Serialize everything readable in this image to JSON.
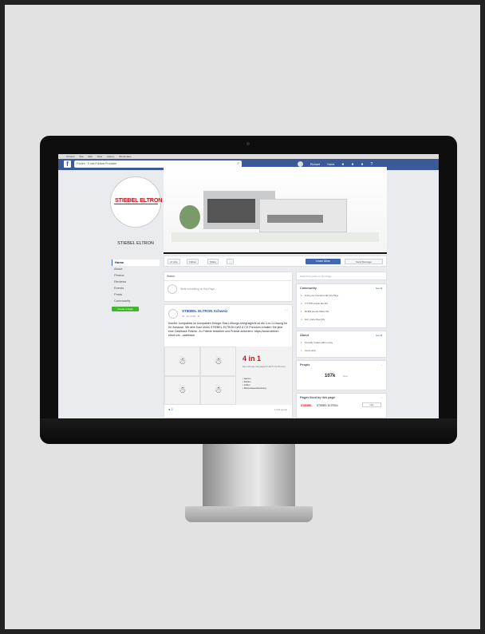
{
  "mac_menubar": {
    "items": [
      "Chrome",
      "File",
      "Edit",
      "View",
      "History",
      "Bookmarks",
      "People",
      "Window",
      "Help"
    ]
  },
  "facebook_bar": {
    "search_value": "Fühlen · 5 mal Fühlbar Produkte",
    "user": "Richard",
    "home": "Home"
  },
  "page": {
    "logo_text": "STIEBEL ELTRON",
    "name": "STIEBEL ELTRON",
    "nav": [
      "Home",
      "About",
      "Photos",
      "Reviews",
      "Events",
      "Posts",
      "Community"
    ],
    "create_page": "Create a Page"
  },
  "action_bar": {
    "like": "Like",
    "follow": "Follow",
    "share": "Share",
    "more": "···",
    "learn_more": "Learn More",
    "send_message": "Send Message"
  },
  "composer": {
    "tab": "Status",
    "placeholder": "Write something on this Page..."
  },
  "post": {
    "author": "STIEBEL ELTRON Schweiz",
    "date": "25. Juli 2018 · ⊕",
    "text": "Kombil: kompaktes im kompakten Design: Das Lüftungs-Integralgerät ist die 4-in-1-Lösung für Ihr Zuhause. Mit dem Kauf eines STIEBEL ELTRON LWZ 8 CS Premium erhalten Sie jetzt eine Cashback Prämie. Zu Prämie bestellen und Prämie anfordern: https://www.stiebel-eltron.ch/...cashback",
    "promo_title": "4 in 1",
    "promo_sub": "Das Lüftungs-Integralgerät LWZ 8 CS Premium",
    "promo_list": [
      "• Heizen",
      "• Kühlen",
      "• Lüften",
      "• Warmwasserbereitung"
    ],
    "reactions": "2",
    "shares": "1 Mal geteilt"
  },
  "right": {
    "search_placeholder": "Search for posts on this Page",
    "community": {
      "title": "Community",
      "see_all": "See All",
      "rows": [
        "Invite your friends to like this Page",
        "777,878 people like this",
        "84,982 people follow this",
        "Jerry Liebe likes this"
      ]
    },
    "about": {
      "title": "About",
      "see_all": "See All",
      "rows": [
        "Typically replies within a day",
        "Community"
      ]
    },
    "people": {
      "title": "People",
      "count": "107k",
      "count_label": "likes"
    },
    "liked": {
      "title": "Pages liked by this page",
      "logo": "STIEBEL",
      "name": "STIEBEL ELTRON",
      "like_btn": "Like"
    }
  }
}
